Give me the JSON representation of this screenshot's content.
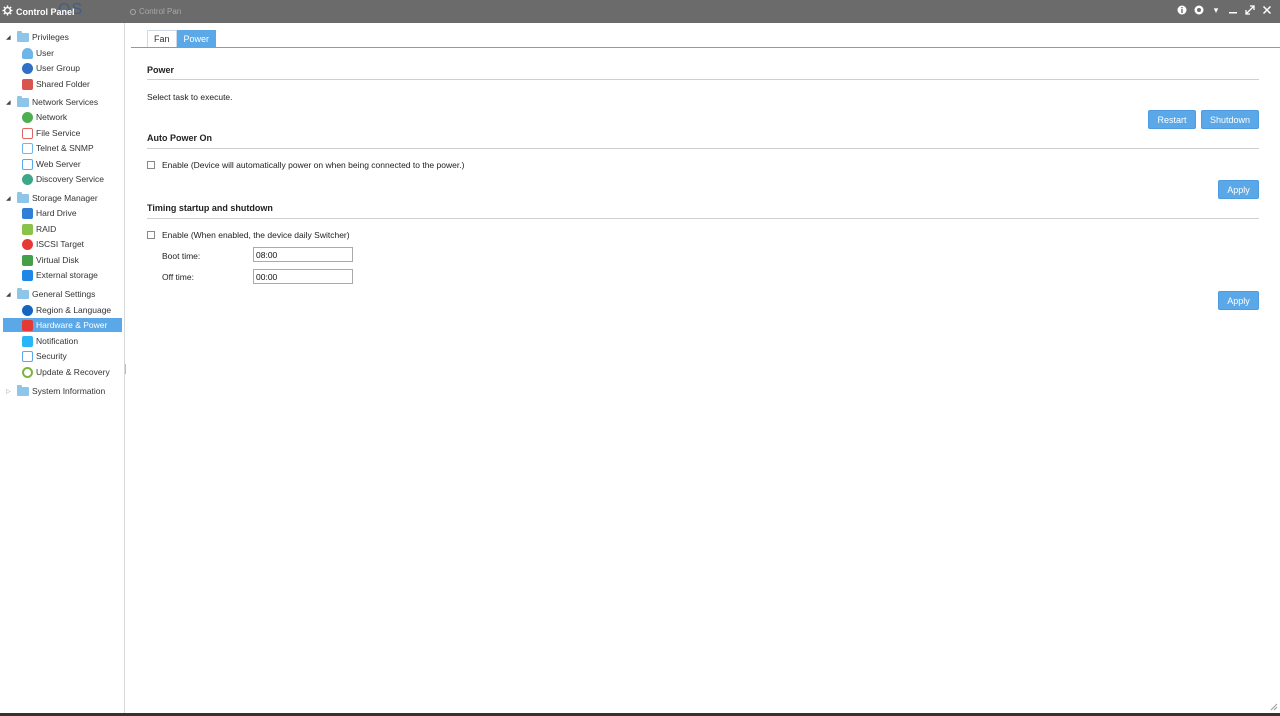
{
  "titlebar": {
    "app_title": "Control Panel",
    "logo_text": "OS",
    "ghost_title": "Control Pan"
  },
  "sidebar": {
    "groups": [
      {
        "label": "Privileges",
        "expanded": true,
        "items": [
          "User",
          "User Group",
          "Shared Folder"
        ]
      },
      {
        "label": "Network Services",
        "expanded": true,
        "items": [
          "Network",
          "File Service",
          "Telnet & SNMP",
          "Web Server",
          "Discovery Service"
        ]
      },
      {
        "label": "Storage Manager",
        "expanded": true,
        "items": [
          "Hard Drive",
          "RAID",
          "ISCSI Target",
          "Virtual Disk",
          "External storage"
        ]
      },
      {
        "label": "General Settings",
        "expanded": true,
        "items": [
          "Region & Language",
          "Hardware & Power",
          "Notification",
          "Security",
          "Update & Recovery"
        ]
      },
      {
        "label": "System Information",
        "expanded": false,
        "items": []
      }
    ],
    "selected_item": "Hardware & Power"
  },
  "tabs": [
    {
      "label": "Fan",
      "active": false
    },
    {
      "label": "Power",
      "active": true
    }
  ],
  "power": {
    "title": "Power",
    "description": "Select task to execute.",
    "restart_label": "Restart",
    "shutdown_label": "Shutdown"
  },
  "auto_power_on": {
    "title": "Auto Power On",
    "enable_label": "Enable (Device will automatically power on when being connected to the power.)",
    "enabled": false,
    "apply_label": "Apply"
  },
  "timing": {
    "title": "Timing startup and shutdown",
    "enable_label": "Enable (When enabled, the device daily Switcher)",
    "enabled": false,
    "boot_label": "Boot time:",
    "boot_value": "08:00",
    "off_label": "Off time:",
    "off_value": "00:00",
    "apply_label": "Apply"
  },
  "colors": {
    "accent": "#5aa8e8",
    "titlebar": "#6b6b6b"
  }
}
